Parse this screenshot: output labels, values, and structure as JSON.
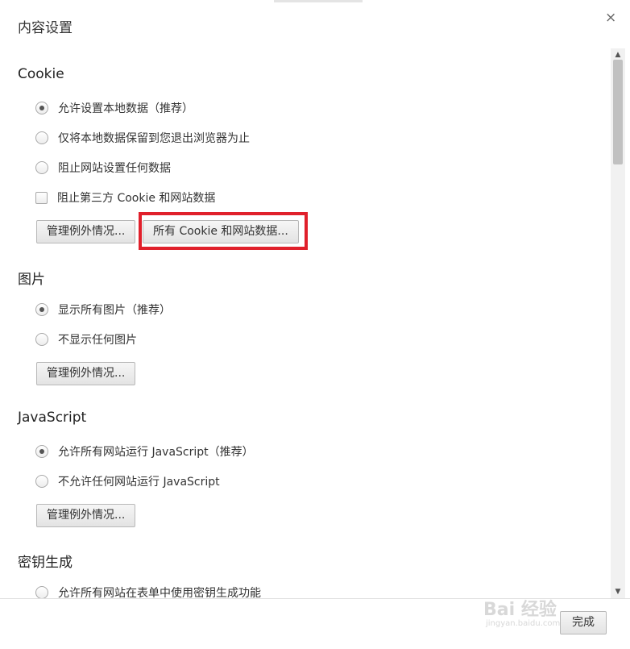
{
  "dialog": {
    "title": "内容设置",
    "close_glyph": "×",
    "done_label": "完成"
  },
  "cookie": {
    "heading": "Cookie",
    "options": [
      {
        "label": "允许设置本地数据（推荐）",
        "checked": true
      },
      {
        "label": "仅将本地数据保留到您退出浏览器为止",
        "checked": false
      },
      {
        "label": "阻止网站设置任何数据",
        "checked": false
      }
    ],
    "block_third_party": {
      "label": "阻止第三方 Cookie 和网站数据",
      "checked": false
    },
    "manage_exceptions_label": "管理例外情况...",
    "all_cookies_label": "所有 Cookie 和网站数据..."
  },
  "images": {
    "heading": "图片",
    "options": [
      {
        "label": "显示所有图片（推荐）",
        "checked": true
      },
      {
        "label": "不显示任何图片",
        "checked": false
      }
    ],
    "manage_exceptions_label": "管理例外情况..."
  },
  "javascript": {
    "heading": "JavaScript",
    "options": [
      {
        "label": "允许所有网站运行 JavaScript（推荐）",
        "checked": true
      },
      {
        "label": "不允许任何网站运行 JavaScript",
        "checked": false
      }
    ],
    "manage_exceptions_label": "管理例外情况..."
  },
  "keygen": {
    "heading": "密钥生成",
    "options": [
      {
        "label": "允许所有网站在表单中使用密钥生成功能",
        "checked": false
      }
    ]
  },
  "watermark": {
    "brand": "Bai 经验",
    "url": "jingyan.baidu.com"
  },
  "colors": {
    "highlight": "#e0202b"
  }
}
